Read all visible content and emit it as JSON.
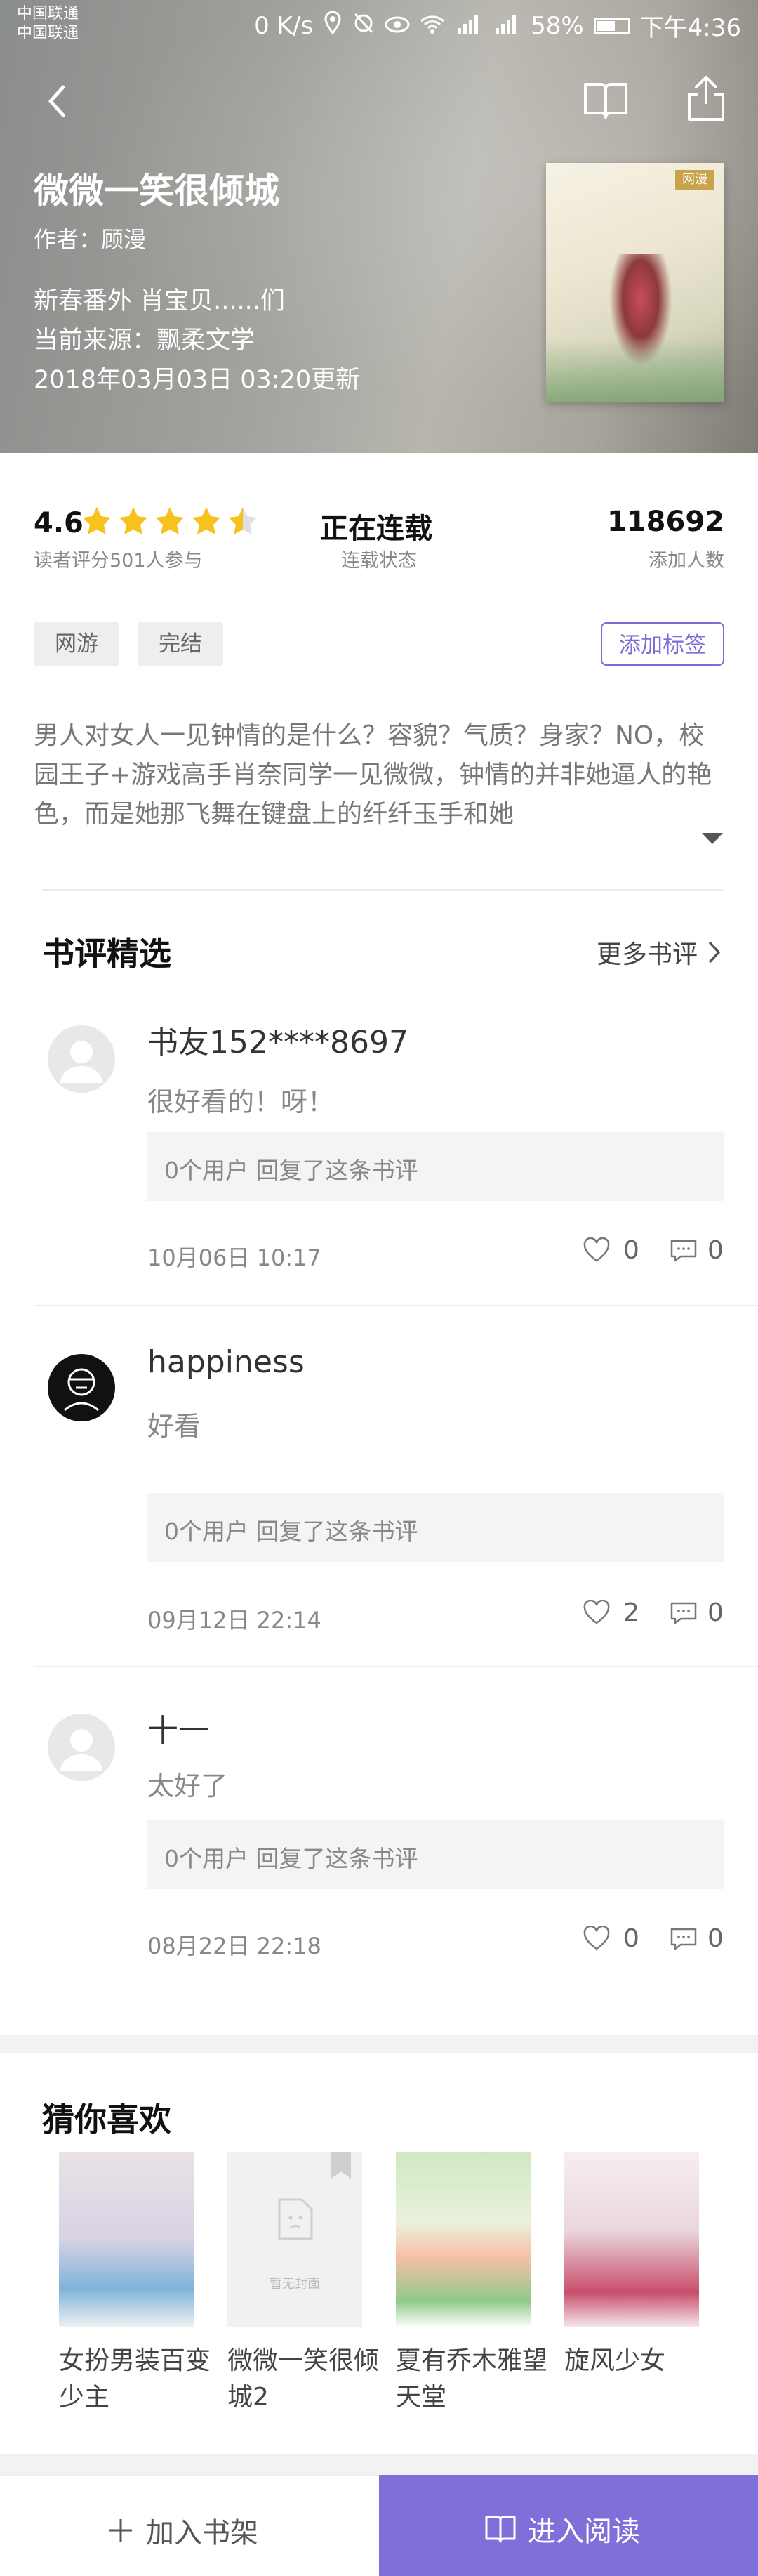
{
  "status_bar": {
    "carrier_1": "中国联通",
    "carrier_2": "中国联通",
    "speed": "0 K/s",
    "battery": "58%",
    "time": "下午4:36"
  },
  "book": {
    "title": "微微一笑很倾城",
    "author": "作者：顾漫",
    "latest_chapter": "新春番外 肖宝贝......们",
    "source": "当前来源：飘柔文学",
    "updated": "2018年03月03日 03:20更新",
    "cover_brand": "网漫"
  },
  "stats": {
    "rating": "4.6",
    "rating_label": "读者评分501人参与",
    "rating_stars": 4.5,
    "status_value": "正在连载",
    "status_label": "连载状态",
    "adds_value": "118692",
    "adds_label": "添加人数"
  },
  "tags": [
    "网游",
    "完结"
  ],
  "add_tag_label": "添加标签",
  "synopsis": "男人对女人一见钟情的是什么？容貌？气质？身家？NO，校园王子+游戏高手肖奈同学一见微微，钟情的并非她逼人的艳色，而是她那飞舞在键盘上的纤纤玉手和她",
  "reviews_section": {
    "title": "书评精选",
    "more": "更多书评",
    "items": [
      {
        "user": "书友152****8697",
        "text": "很好看的！呀！",
        "reply": "0个用户 回复了这条书评",
        "date": "10月06日 10:17",
        "likes": "0",
        "comments": "0"
      },
      {
        "user": "happiness",
        "text": "好看",
        "reply": "0个用户 回复了这条书评",
        "date": "09月12日 22:14",
        "likes": "2",
        "comments": "0"
      },
      {
        "user": "十一",
        "text": "太好了",
        "reply": "0个用户 回复了这条书评",
        "date": "08月22日 22:18",
        "likes": "0",
        "comments": "0"
      }
    ]
  },
  "recommend": {
    "title": "猜你喜欢",
    "no_cover": "暂无封面",
    "books": [
      "女扮男装百变少主",
      "微微一笑很倾城2",
      "夏有乔木雅望天堂",
      "旋风少女"
    ]
  },
  "footer": {
    "add_shelf": "加入书架",
    "read": "进入阅读"
  },
  "colors": {
    "accent": "#7e70d8",
    "star": "#f7c21e"
  }
}
